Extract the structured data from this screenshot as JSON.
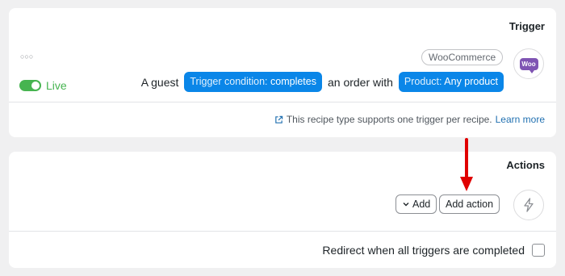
{
  "trigger_card": {
    "title": "Trigger",
    "menu_icon": "dots-menu-icon",
    "status_label": "Live",
    "status_on": true,
    "integration_tag": "WooCommerce",
    "integration_icon_text": "Woo",
    "sentence": {
      "prefix": "A guest",
      "token1_label": "Trigger condition:",
      "token1_value": "completes",
      "middle": "an order with",
      "token2_label": "Product:",
      "token2_value": "Any product"
    },
    "note_text": "This recipe type supports one trigger per recipe.",
    "note_link": "Learn more"
  },
  "actions_card": {
    "title": "Actions",
    "add_label": "Add",
    "add_action_label": "Add action",
    "action_icon": "bolt-icon",
    "redirect_label": "Redirect when all triggers are completed",
    "redirect_checked": false
  },
  "colors": {
    "accent_blue": "#0a86e8",
    "live_green": "#46b450",
    "woo_purple": "#7f54b3",
    "arrow_red": "#e00000"
  }
}
